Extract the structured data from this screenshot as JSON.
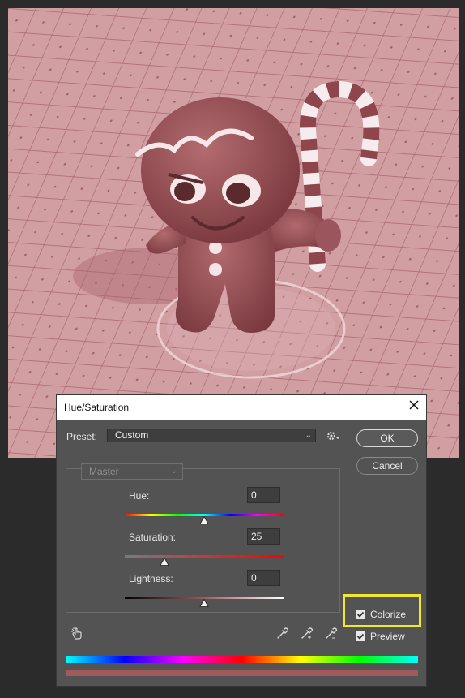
{
  "dialog": {
    "title": "Hue/Saturation",
    "preset_label": "Preset:",
    "preset_value": "Custom",
    "channel_value": "Master",
    "ok_label": "OK",
    "cancel_label": "Cancel",
    "sliders": [
      {
        "label": "Hue:",
        "value": "0",
        "range": [
          -180,
          180
        ]
      },
      {
        "label": "Saturation:",
        "value": "25",
        "range": [
          0,
          100
        ]
      },
      {
        "label": "Lightness:",
        "value": "0",
        "range": [
          -100,
          100
        ]
      }
    ],
    "colorize": {
      "label": "Colorize",
      "checked": true,
      "highlighted_color": "#f2e72a"
    },
    "preview": {
      "label": "Preview",
      "checked": true
    },
    "result_color": "#a05a5c"
  },
  "icons": {
    "close": "close-icon",
    "gear": "gear-icon",
    "hand": "targeted-adjustment-hand-icon",
    "eyedropper": "eyedropper-icon",
    "eyedropper_plus": "eyedropper-plus-icon",
    "eyedropper_minus": "eyedropper-minus-icon"
  }
}
